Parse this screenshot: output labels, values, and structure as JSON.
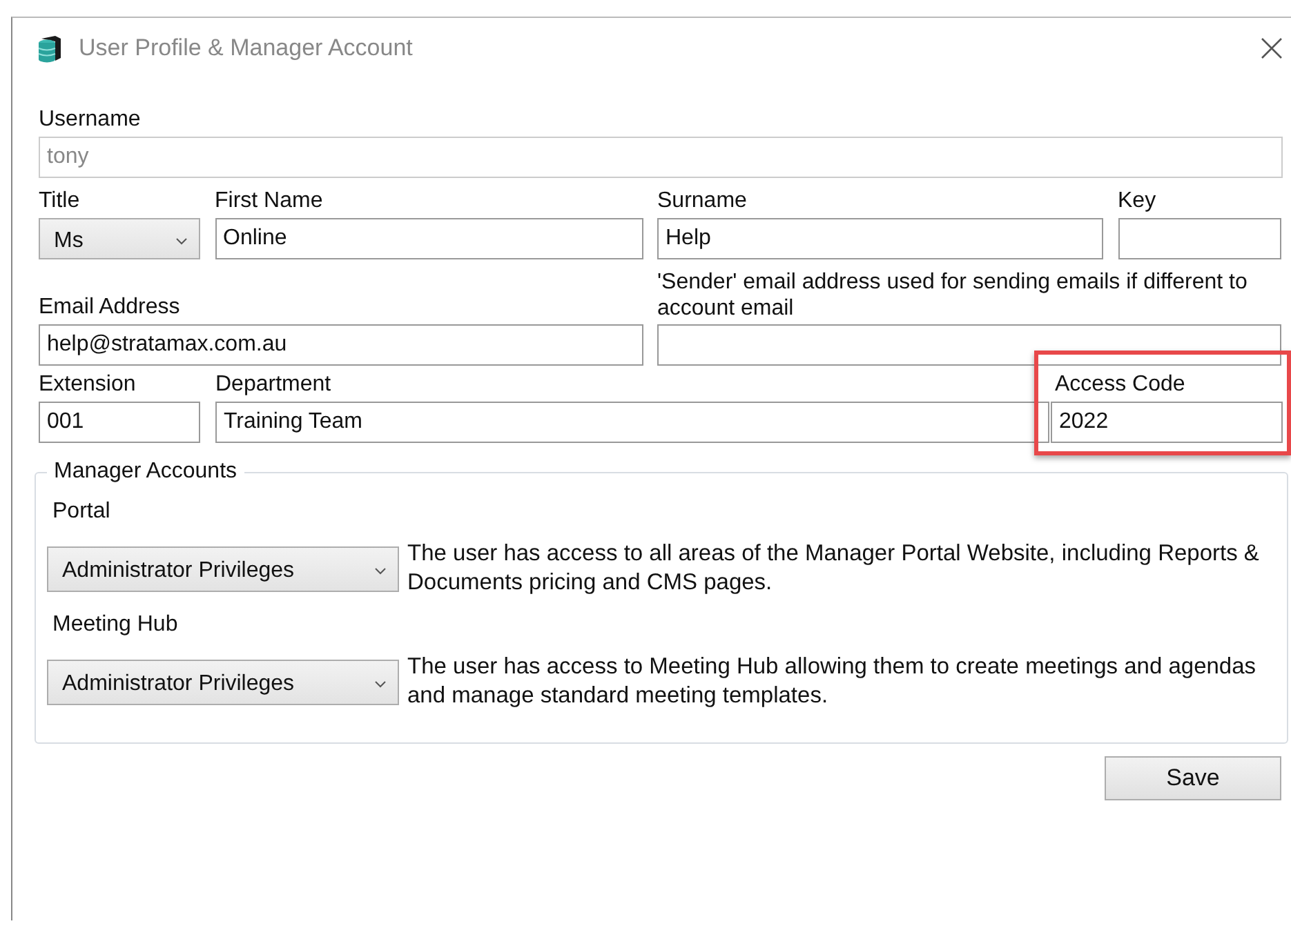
{
  "window": {
    "title": "User Profile & Manager Account"
  },
  "username": {
    "label": "Username",
    "value": "tony",
    "disabled": true
  },
  "title": {
    "label": "Title",
    "value": "Ms"
  },
  "first_name": {
    "label": "First Name",
    "value": "Online"
  },
  "surname": {
    "label": "Surname",
    "value": "Help"
  },
  "key": {
    "label": "Key"
  },
  "email": {
    "label": "Email Address",
    "value": "help@stratamax.com.au"
  },
  "sender_email": {
    "label": "'Sender' email address used for sending emails if different to account email"
  },
  "extension": {
    "label": "Extension",
    "value": "001"
  },
  "department": {
    "label": "Department",
    "value": "Training Team"
  },
  "access_code": {
    "label": "Access Code",
    "value": "2022",
    "highlighted": true
  },
  "manager_accounts": {
    "title": "Manager Accounts",
    "items": [
      {
        "label": "Portal",
        "value": "Administrator Privileges",
        "description": "The user has access to all areas of the Manager Portal Website, including Reports & Documents pricing and CMS pages."
      },
      {
        "label": "Meeting Hub",
        "value": "Administrator Privileges",
        "description": "The user has access to Meeting Hub allowing them to create meetings and agendas and manage standard meeting templates."
      }
    ]
  },
  "buttons": [
    {
      "label": "Save"
    }
  ]
}
